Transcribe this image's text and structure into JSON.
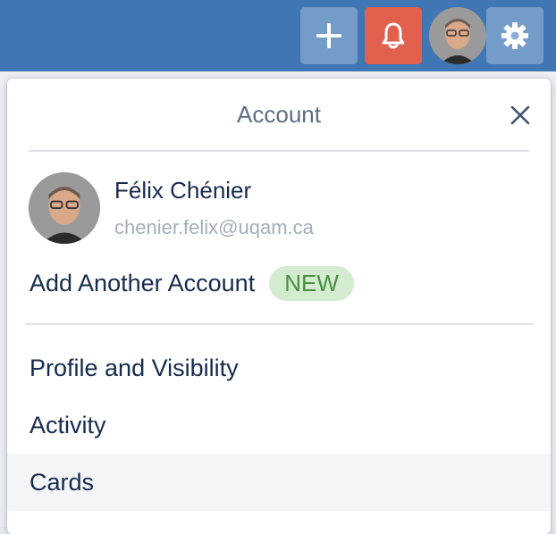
{
  "topbar": {
    "add_icon": "plus-icon",
    "notification_icon": "bell-icon",
    "settings_icon": "gear-icon",
    "colors": {
      "bar": "#3f76b3",
      "bell": "#e2604e"
    }
  },
  "account_panel": {
    "title": "Account",
    "close_icon": "close-icon",
    "user": {
      "name": "Félix Chénier",
      "email": "chenier.felix@uqam.ca"
    },
    "add_account_label": "Add Another Account",
    "new_badge": "NEW",
    "menu": [
      {
        "label": "Profile and Visibility"
      },
      {
        "label": "Activity"
      },
      {
        "label": "Cards",
        "highlighted": true
      }
    ]
  }
}
